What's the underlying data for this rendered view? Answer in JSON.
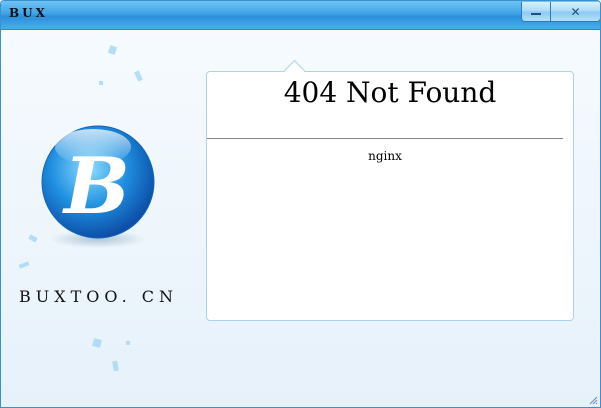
{
  "window": {
    "title": "BUX",
    "controls": {
      "minimize_icon": "minimize-icon",
      "close_icon": "close-icon",
      "close_glyph": "✕"
    }
  },
  "logo": {
    "letter": "B",
    "caption": "BUXTOO. CN"
  },
  "panel": {
    "heading": "404 Not Found",
    "server": "nginx"
  },
  "colors": {
    "titlebar": "#3fa3e8",
    "logo_sphere": "#1e82d6",
    "panel_border": "#a9d3ef",
    "background": "#eef6fc"
  }
}
